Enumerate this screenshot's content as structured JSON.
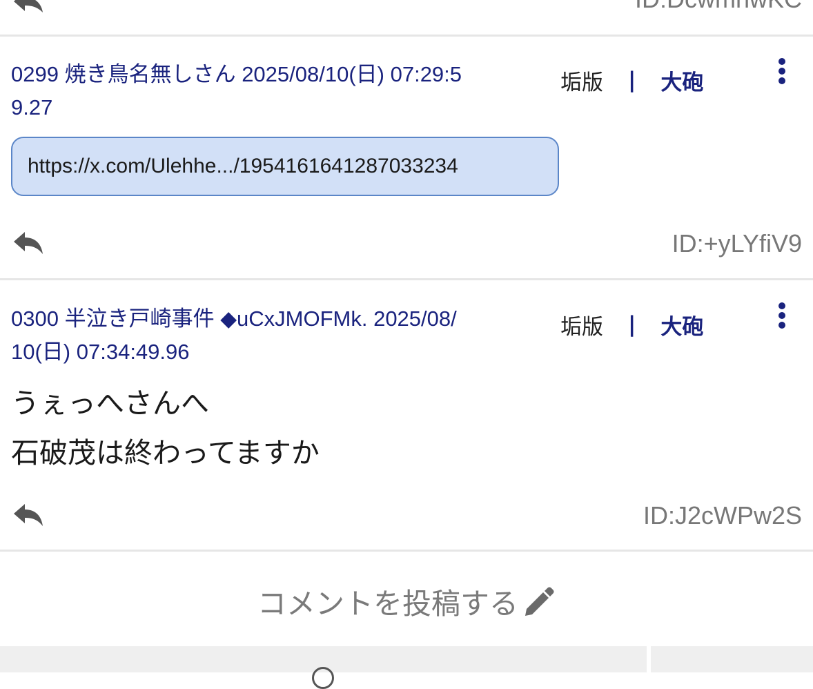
{
  "previous_post": {
    "id_text": "ID:DcwmnwKC"
  },
  "posts": [
    {
      "number": "0299",
      "name": "焼き鳥名無しさん",
      "trip": "",
      "datetime": "2025/08/10(日) 07:29:59.27",
      "header_line1": "0299 焼き鳥名無しさん 2025/08/10(日) 07:29:5",
      "header_line2": "9.27",
      "link": "https://x.com/Ulehhe.../1954161641287033234",
      "body_lines": [],
      "id_text": "ID:+yLYfiV9"
    },
    {
      "number": "0300",
      "name": "半泣き戸崎事件",
      "trip": "◆uCxJMOFMk.",
      "datetime": "2025/08/10(日) 07:34:49.96",
      "header_line1": "0300 半泣き戸崎事件 ◆uCxJMOFMk. 2025/08/",
      "header_line2": "10(日) 07:34:49.96",
      "link": "",
      "body_lines": [
        "うぇっへさんへ",
        "石破茂は終わってますか"
      ],
      "id_text": "ID:J2cWPw2S"
    }
  ],
  "tools": {
    "grime_label": "垢版",
    "separator": "|",
    "cannon_label": "大砲"
  },
  "comment_cta": {
    "label": "コメントを投稿する"
  },
  "icons": {
    "reply": "reply-arrow-icon",
    "more": "more-vertical-icon",
    "pencil": "pencil-icon"
  },
  "colors": {
    "header_text": "#1a237e",
    "link_bg": "#d2e0f7",
    "link_border": "#5b86c8",
    "id_text": "#777777",
    "divider": "#e6e6e6"
  }
}
